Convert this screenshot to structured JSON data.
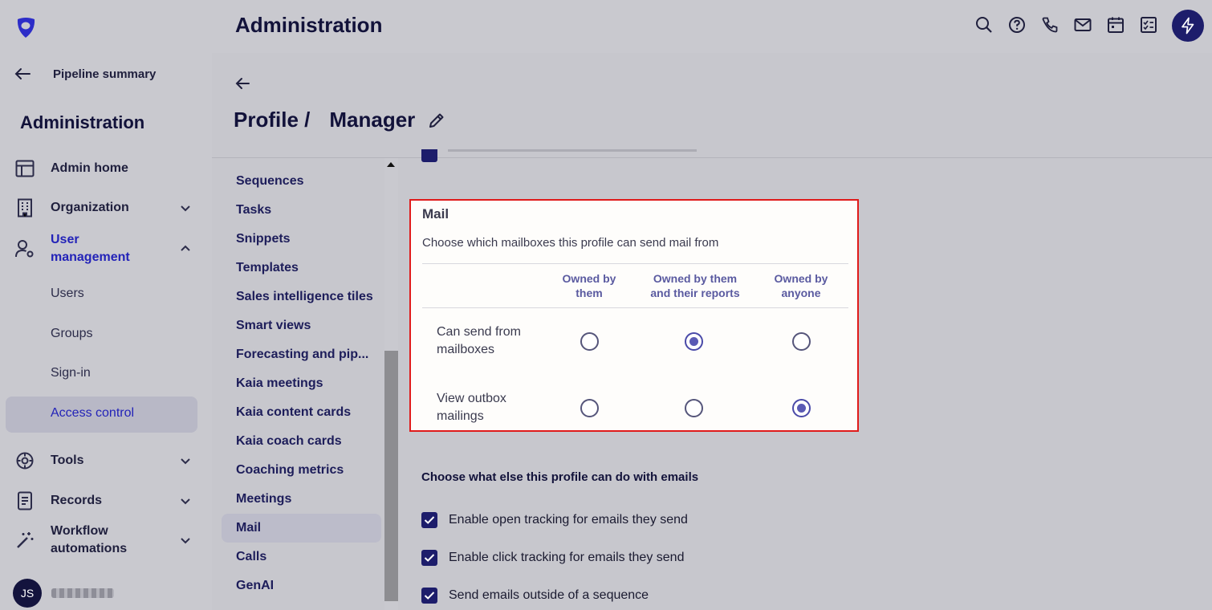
{
  "header": {
    "title": "Administration",
    "icons": [
      "search-icon",
      "help-icon",
      "phone-icon",
      "mail-icon",
      "calendar-icon",
      "tasks-icon",
      "bolt-icon"
    ]
  },
  "sidebar": {
    "back_label": "Pipeline summary",
    "title": "Administration",
    "items": [
      {
        "label": "Admin home",
        "icon": "admin-home-icon"
      },
      {
        "label": "Organization",
        "icon": "building-icon"
      },
      {
        "label": "User management",
        "icon": "user-settings-icon",
        "expanded": true
      },
      {
        "label": "Tools",
        "icon": "tools-icon"
      },
      {
        "label": "Records",
        "icon": "records-icon"
      },
      {
        "label": "Workflow automations",
        "icon": "workflow-icon"
      }
    ],
    "sub_items": [
      "Users",
      "Groups",
      "Sign-in",
      "Access control"
    ],
    "active_sub_item": "Access control",
    "user_initials": "JS"
  },
  "profile": {
    "title": "Profile /",
    "name": "Manager"
  },
  "sections": [
    "Sequences",
    "Tasks",
    "Snippets",
    "Templates",
    "Sales intelligence tiles",
    "Smart views",
    "Forecasting and pip...",
    "Kaia meetings",
    "Kaia content cards",
    "Kaia coach cards",
    "Coaching metrics",
    "Meetings",
    "Mail",
    "Calls",
    "GenAI"
  ],
  "active_section": "Mail",
  "mail": {
    "title": "Mail",
    "description": "Choose which mailboxes this profile can send mail from",
    "columns": [
      [
        "Owned by",
        "them"
      ],
      [
        "Owned by them",
        "and their reports"
      ],
      [
        "Owned by",
        "anyone"
      ]
    ],
    "rows": [
      {
        "label": [
          "Can send from",
          "mailboxes"
        ],
        "selected": 1
      },
      {
        "label": [
          "View outbox",
          "mailings"
        ],
        "selected": 2
      }
    ]
  },
  "email_options": {
    "title": "Choose what else this profile can do with emails",
    "items": [
      {
        "label": "Enable open tracking for emails they send",
        "checked": true
      },
      {
        "label": "Enable click tracking for emails they send",
        "checked": true
      },
      {
        "label": "Send emails outside of a sequence",
        "checked": true
      }
    ]
  }
}
